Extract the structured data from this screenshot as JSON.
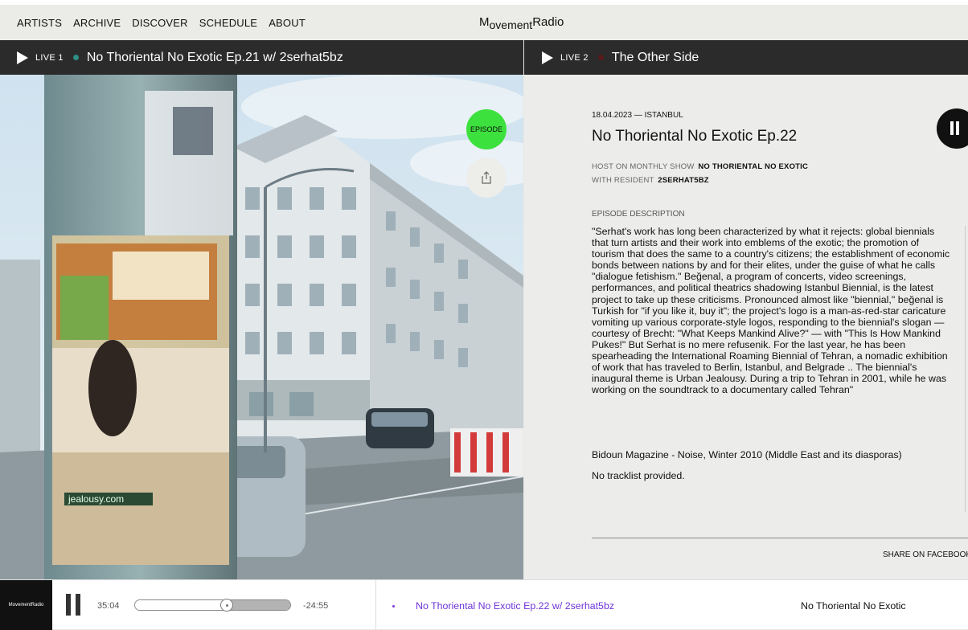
{
  "nav": {
    "items": [
      "ARTISTS",
      "ARCHIVE",
      "DISCOVER",
      "SCHEDULE",
      "ABOUT"
    ],
    "logo_main": "M",
    "logo_sub": "ovement",
    "logo_end": "Radio"
  },
  "live1": {
    "label": "LIVE 1",
    "title": "No Thoriental No Exotic Ep.21 w/ 2serhat5bz",
    "dot_color": "#2f8f86"
  },
  "live2": {
    "label": "LIVE 2",
    "title": "The Other Side",
    "dot_color": "#5a1a1a"
  },
  "image": {
    "episode_label": "EPISODE",
    "share_icon": "share-icon",
    "poster_text": "jealousy.com"
  },
  "detail": {
    "date": "18.04.2023 — ISTANBUL",
    "title": "No Thoriental No Exotic Ep.22",
    "host_prefix": "HOST ON MONTHLY SHOW",
    "host_show": "NO THORIENTAL NO EXOTIC",
    "resident_prefix": "WITH RESIDENT",
    "resident_name": "2SERHAT5BZ",
    "description_label": "EPISODE DESCRIPTION",
    "description": "\"Serhat's work has long been characterized by what it  rejects: global biennials that turn artists and their work  into emblems of the exotic; the promotion of tourism that  does the same to a country's citizens; the establishment  of economic bonds between nations by and for their elites, under the guise of what he calls \"dialogue fetishism.\" Beğenal, a program of concerts, video screenings, performances, and political theatrics shadowing Istanbul Biennial, is the latest project to take up these criticisms. Pronounced almost like \"biennial,\"  beğenal is Turkish for \"if you like it, buy it\"; the project's  logo is a man-as-red-star caricature vomiting up various corporate-style logos, responding to the biennial's slogan — courtesy of Brecht: \"What Keeps Mankind Alive?\" — with \"This Is How Mankind Pukes!\" But Serhat  is no mere refusenik. For the last year, he has been spearheading the International Roaming Biennial of Tehran, a nomadic exhibition of work that has traveled to Berlin, Istanbul, and Belgrade .. The biennial's inaugural theme is Urban Jealousy. During a trip to Tehran in 2001, while he was working on the soundtrack to a documentary called Tehran\"",
    "source": "Bidoun Magazine - Noise, Winter 2010 (Middle East and its diasporas)",
    "tracklist": "No tracklist provided.",
    "share_label": "SHARE ON FACEBOOK"
  },
  "player": {
    "logo_text": "MovementRadio",
    "elapsed": "35:04",
    "remaining": "-24:55",
    "progress": 0.59,
    "title": "No Thoriental No Exotic Ep.22 w/ 2serhat5bz",
    "show": "No Thoriental No Exotic",
    "accent": "#6f35d8"
  }
}
